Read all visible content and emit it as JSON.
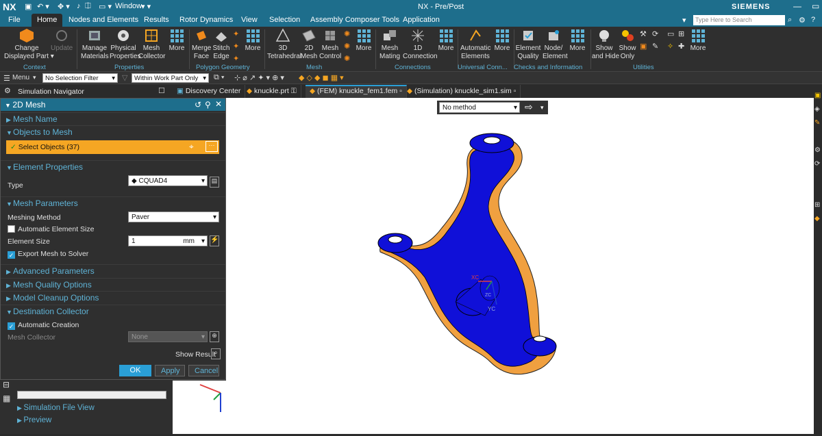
{
  "app": {
    "logo": "NX",
    "window_menu": "Window",
    "title": "NX - Pre/Post",
    "brand": "SIEMENS",
    "search_placeholder": "Type Here to Search"
  },
  "menu_tabs": [
    "File",
    "Home",
    "Nodes and Elements",
    "Results",
    "Rotor Dynamics",
    "View",
    "Selection",
    "Assembly Composer Tools",
    "Application"
  ],
  "ribbon": {
    "buttons": [
      {
        "label": "Change\nDisplayed Part ▾",
        "icon": "change-part-icon"
      },
      {
        "label": "Update",
        "icon": "update-icon"
      },
      {
        "label": "Manage\nMaterials",
        "icon": "materials-icon"
      },
      {
        "label": "Physical\nProperties",
        "icon": "physical-properties-icon"
      },
      {
        "label": "Mesh\nCollector",
        "icon": "mesh-collector-icon"
      },
      {
        "label": "More",
        "icon": "more-grid-icon"
      },
      {
        "label": "Merge\nFace",
        "icon": "merge-face-icon"
      },
      {
        "label": "Stitch\nEdge",
        "icon": "stitch-edge-icon"
      },
      {
        "label": "More",
        "icon": "more-grid-icon"
      },
      {
        "label": "3D\nTetrahedral",
        "icon": "tetra-icon"
      },
      {
        "label": "2D\nMesh",
        "icon": "mesh2d-icon"
      },
      {
        "label": "Mesh\nControl",
        "icon": "mesh-control-icon"
      },
      {
        "label": "More",
        "icon": "more-grid-icon"
      },
      {
        "label": "Mesh\nMating",
        "icon": "mesh-mating-icon"
      },
      {
        "label": "1D\nConnection",
        "icon": "connection-icon"
      },
      {
        "label": "More",
        "icon": "more-grid-icon"
      },
      {
        "label": "Automatic\nElements",
        "icon": "auto-elements-icon"
      },
      {
        "label": "More",
        "icon": "more-grid-icon"
      },
      {
        "label": "Element\nQuality",
        "icon": "element-quality-icon"
      },
      {
        "label": "Node/\nElement",
        "icon": "node-element-icon"
      },
      {
        "label": "More",
        "icon": "more-grid-icon"
      },
      {
        "label": "Show\nand Hide",
        "icon": "show-hide-icon"
      },
      {
        "label": "Show\nOnly",
        "icon": "show-only-icon"
      },
      {
        "label": "More",
        "icon": "more-grid-icon"
      }
    ],
    "groups": [
      "Context",
      "Properties",
      "Polygon Geometry",
      "Mesh",
      "Connections",
      "Universal Conn...",
      "Checks and Information",
      "Utilities"
    ]
  },
  "toolbar": {
    "menu": "Menu",
    "filter": "No Selection Filter",
    "scope": "Within Work Part Only"
  },
  "nav": {
    "sim_navigator": "Simulation Navigator",
    "tabs": [
      "Discovery Center",
      "knuckle.prt",
      "(FEM) knuckle_fem1.fem",
      "(Simulation) knuckle_sim1.sim"
    ]
  },
  "dialog": {
    "title": "2D Mesh",
    "sections": {
      "mesh_name": "Mesh Name",
      "objects": "Objects to Mesh",
      "element_props": "Element Properties",
      "mesh_params": "Mesh Parameters",
      "advanced": "Advanced Parameters",
      "quality": "Mesh Quality Options",
      "cleanup": "Model Cleanup Options",
      "destination": "Destination Collector"
    },
    "select_objects": "Select Objects (37)",
    "type_label": "Type",
    "type_value": "CQUAD4",
    "meshing_method_label": "Meshing Method",
    "meshing_method_value": "Paver",
    "auto_size_label": "Automatic Element Size",
    "element_size_label": "Element Size",
    "element_size_value": "1",
    "element_size_unit": "mm",
    "export_label": "Export Mesh to Solver",
    "auto_creation_label": "Automatic Creation",
    "mesh_collector_label": "Mesh Collector",
    "mesh_collector_value": "None",
    "show_result": "Show Result",
    "ok": "OK",
    "apply": "Apply",
    "cancel": "Cancel"
  },
  "lower_nav": {
    "file_view": "Simulation File View",
    "preview": "Preview"
  },
  "viewport": {
    "method_value": "No method",
    "axis_xc": "XC",
    "axis_yc": "YC",
    "axis_zc": "ZC"
  },
  "colors": {
    "accent": "#1e6e8c",
    "highlight": "#f5a623",
    "part_blue": "#1010d8",
    "part_orange": "#f0a040"
  }
}
